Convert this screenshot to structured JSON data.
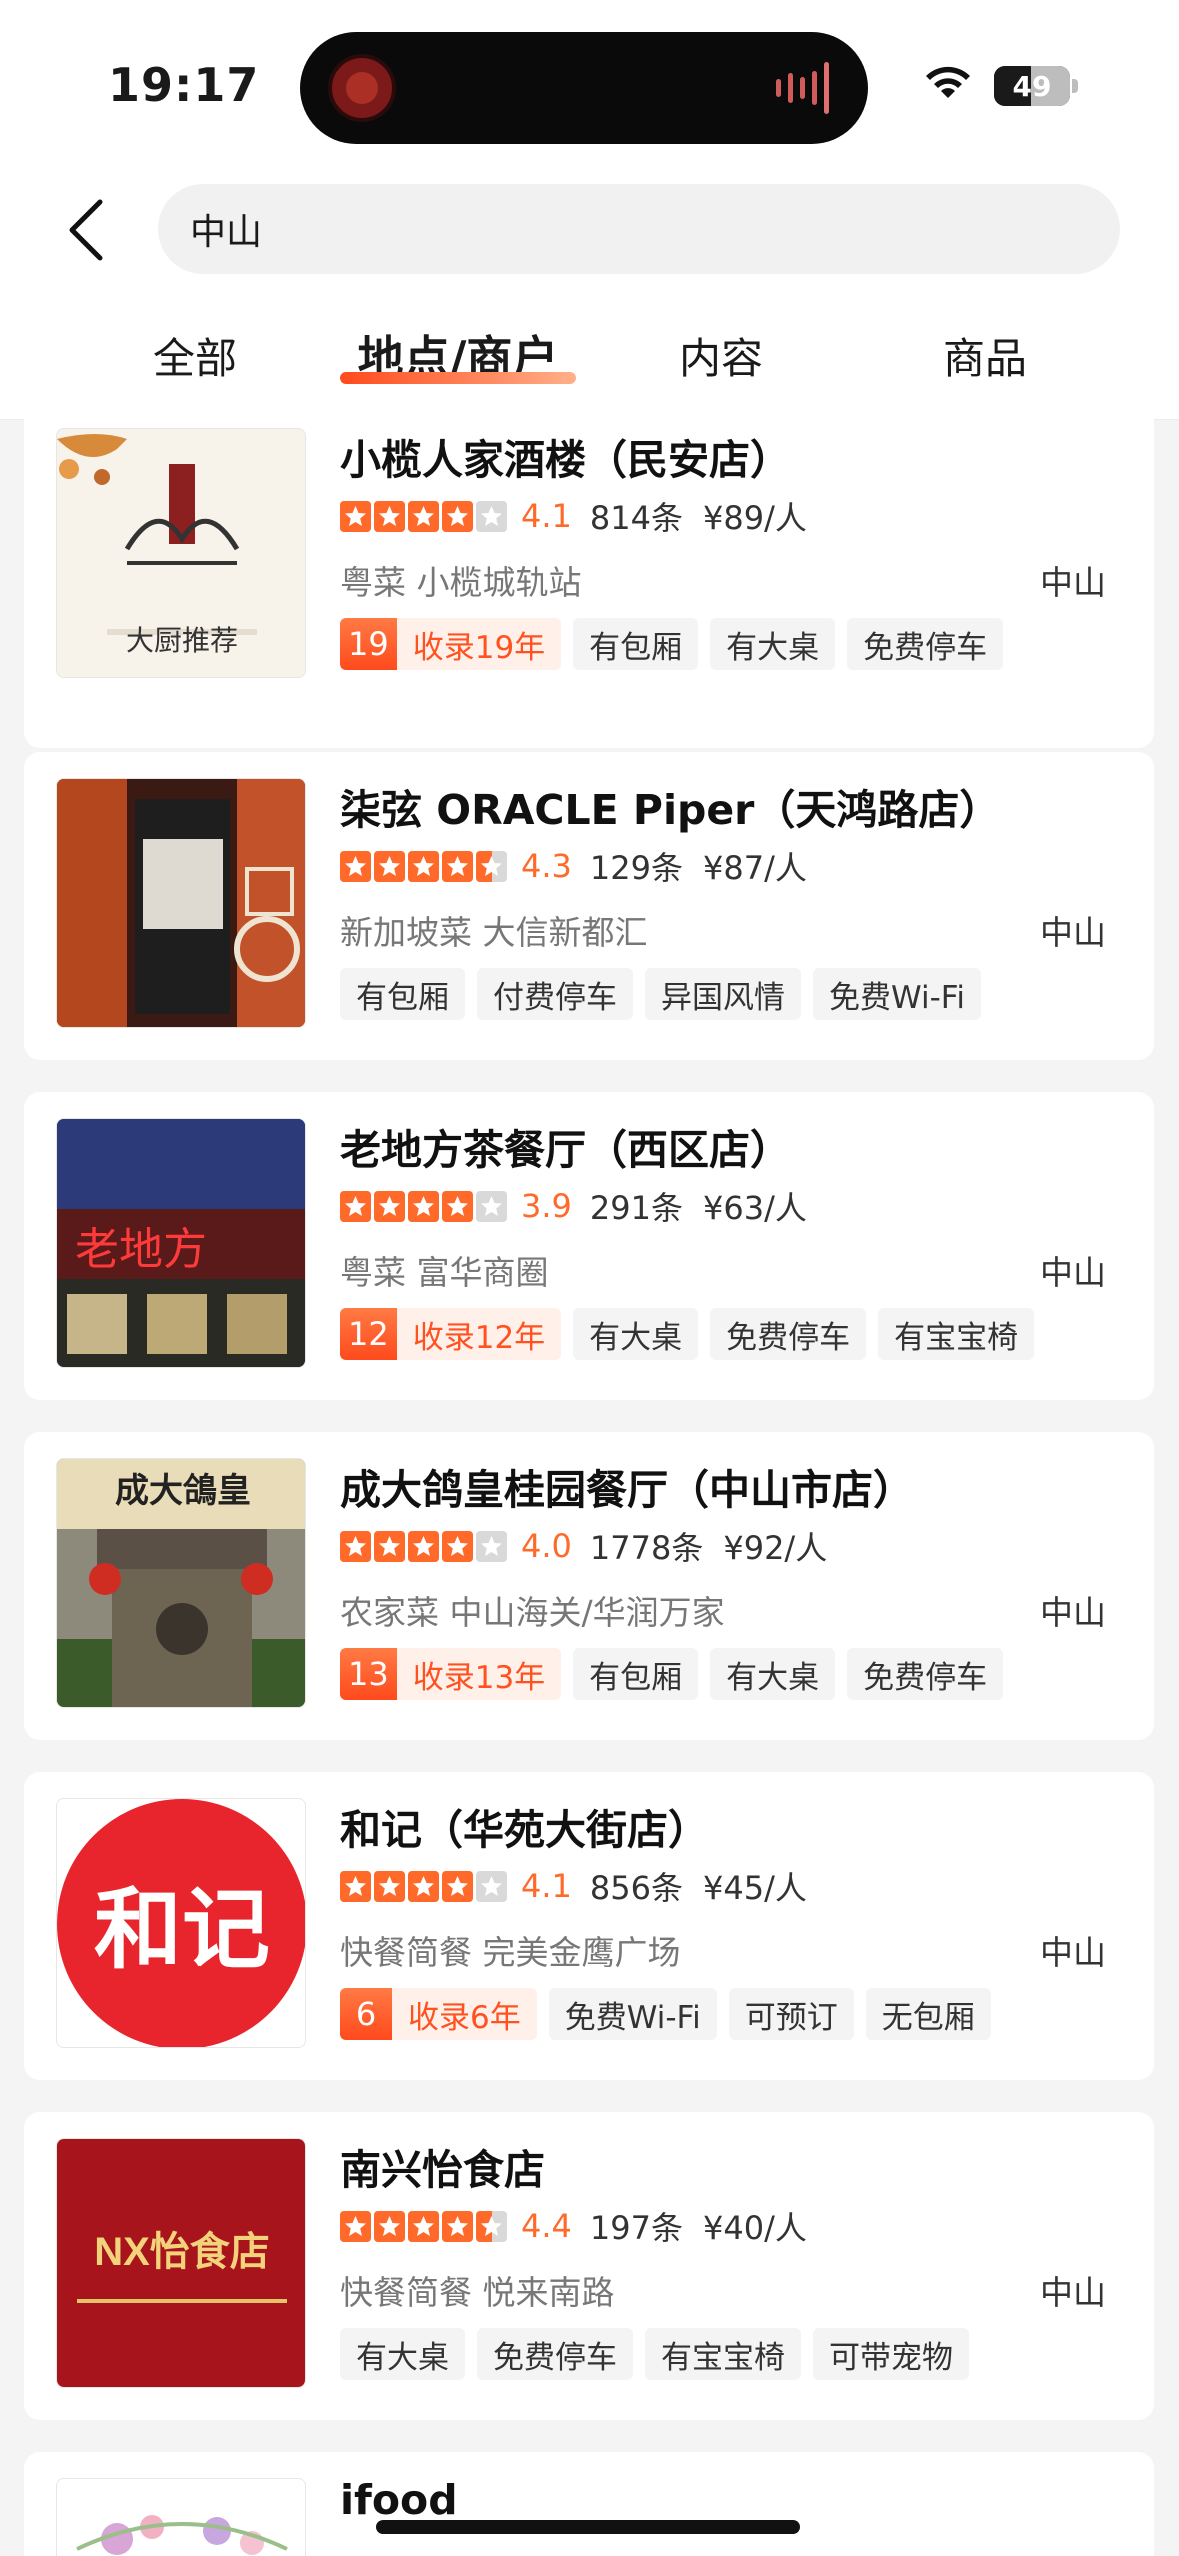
{
  "status_bar": {
    "time": "19:17",
    "battery": "49",
    "battery_level": 0.49
  },
  "search": {
    "query": "中山"
  },
  "tabs": [
    {
      "label": "全部"
    },
    {
      "label": "地点/商户"
    },
    {
      "label": "内容"
    },
    {
      "label": "商品"
    }
  ],
  "active_tab": "地点/商户",
  "colors": {
    "accent": "#ff6a2a",
    "tag_bg": "#f4f4f4",
    "record_bg": "#fff0ea"
  },
  "results": [
    {
      "name": "小榄人家酒楼（民安店）",
      "rating": 4.1,
      "score": "4.1",
      "reviews": "814条",
      "price": "¥89/人",
      "meta": "粤菜 小榄城轨站",
      "region": "中山",
      "record": {
        "num": "19",
        "text": "收录19年"
      },
      "tags": [
        "有包厢",
        "有大桌",
        "免费停车"
      ],
      "thumb_text": "大厨推荐"
    },
    {
      "name": "柒弦 ORACLE Piper（天鸿路店）",
      "rating": 4.3,
      "score": "4.3",
      "reviews": "129条",
      "price": "¥87/人",
      "meta": "新加坡菜 大信新都汇",
      "region": "中山",
      "record": null,
      "tags": [
        "有包厢",
        "付费停车",
        "异国风情",
        "免费Wi-Fi"
      ]
    },
    {
      "name": "老地方茶餐厅（西区店）",
      "rating": 3.9,
      "score": "3.9",
      "reviews": "291条",
      "price": "¥63/人",
      "meta": "粤菜 富华商圈",
      "region": "中山",
      "record": {
        "num": "12",
        "text": "收录12年"
      },
      "tags": [
        "有大桌",
        "免费停车",
        "有宝宝椅"
      ]
    },
    {
      "name": "成大鸽皇桂园餐厅（中山市店）",
      "rating": 4.0,
      "score": "4.0",
      "reviews": "1778条",
      "price": "¥92/人",
      "meta": "农家菜 中山海关/华润万家",
      "region": "中山",
      "record": {
        "num": "13",
        "text": "收录13年"
      },
      "tags": [
        "有包厢",
        "有大桌",
        "免费停车"
      ],
      "thumb_text": "成大鴿皇"
    },
    {
      "name": "和记（华苑大街店）",
      "rating": 4.1,
      "score": "4.1",
      "reviews": "856条",
      "price": "¥45/人",
      "meta": "快餐简餐 完美金鹰广场",
      "region": "中山",
      "record": {
        "num": "6",
        "text": "收录6年"
      },
      "tags": [
        "免费Wi-Fi",
        "可预订",
        "无包厢"
      ],
      "thumb_text": "和记"
    },
    {
      "name": "南兴怡食店",
      "rating": 4.4,
      "score": "4.4",
      "reviews": "197条",
      "price": "¥40/人",
      "meta": "快餐简餐 悦来南路",
      "region": "中山",
      "record": null,
      "tags": [
        "有大桌",
        "免费停车",
        "有宝宝椅",
        "可带宠物"
      ],
      "thumb_text": "NX怡食店"
    },
    {
      "name": "ifood",
      "partial": true
    }
  ]
}
